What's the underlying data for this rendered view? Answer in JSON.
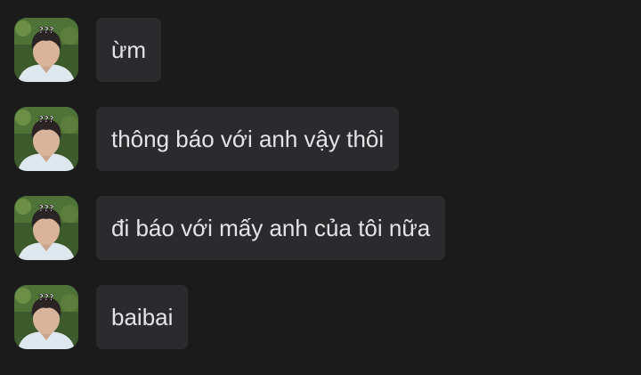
{
  "messages": [
    {
      "text": "ừm",
      "avatar": "profile-photo"
    },
    {
      "text": "thông báo với anh vậy thôi",
      "avatar": "profile-photo"
    },
    {
      "text": "đi báo với mấy anh của tôi nữa",
      "avatar": "profile-photo"
    },
    {
      "text": "baibai",
      "avatar": "profile-photo"
    }
  ],
  "avatar_overlay_text": "???",
  "colors": {
    "background": "#1b1b1c",
    "bubble": "#2b2b2d",
    "text": "#e4e4e6"
  }
}
